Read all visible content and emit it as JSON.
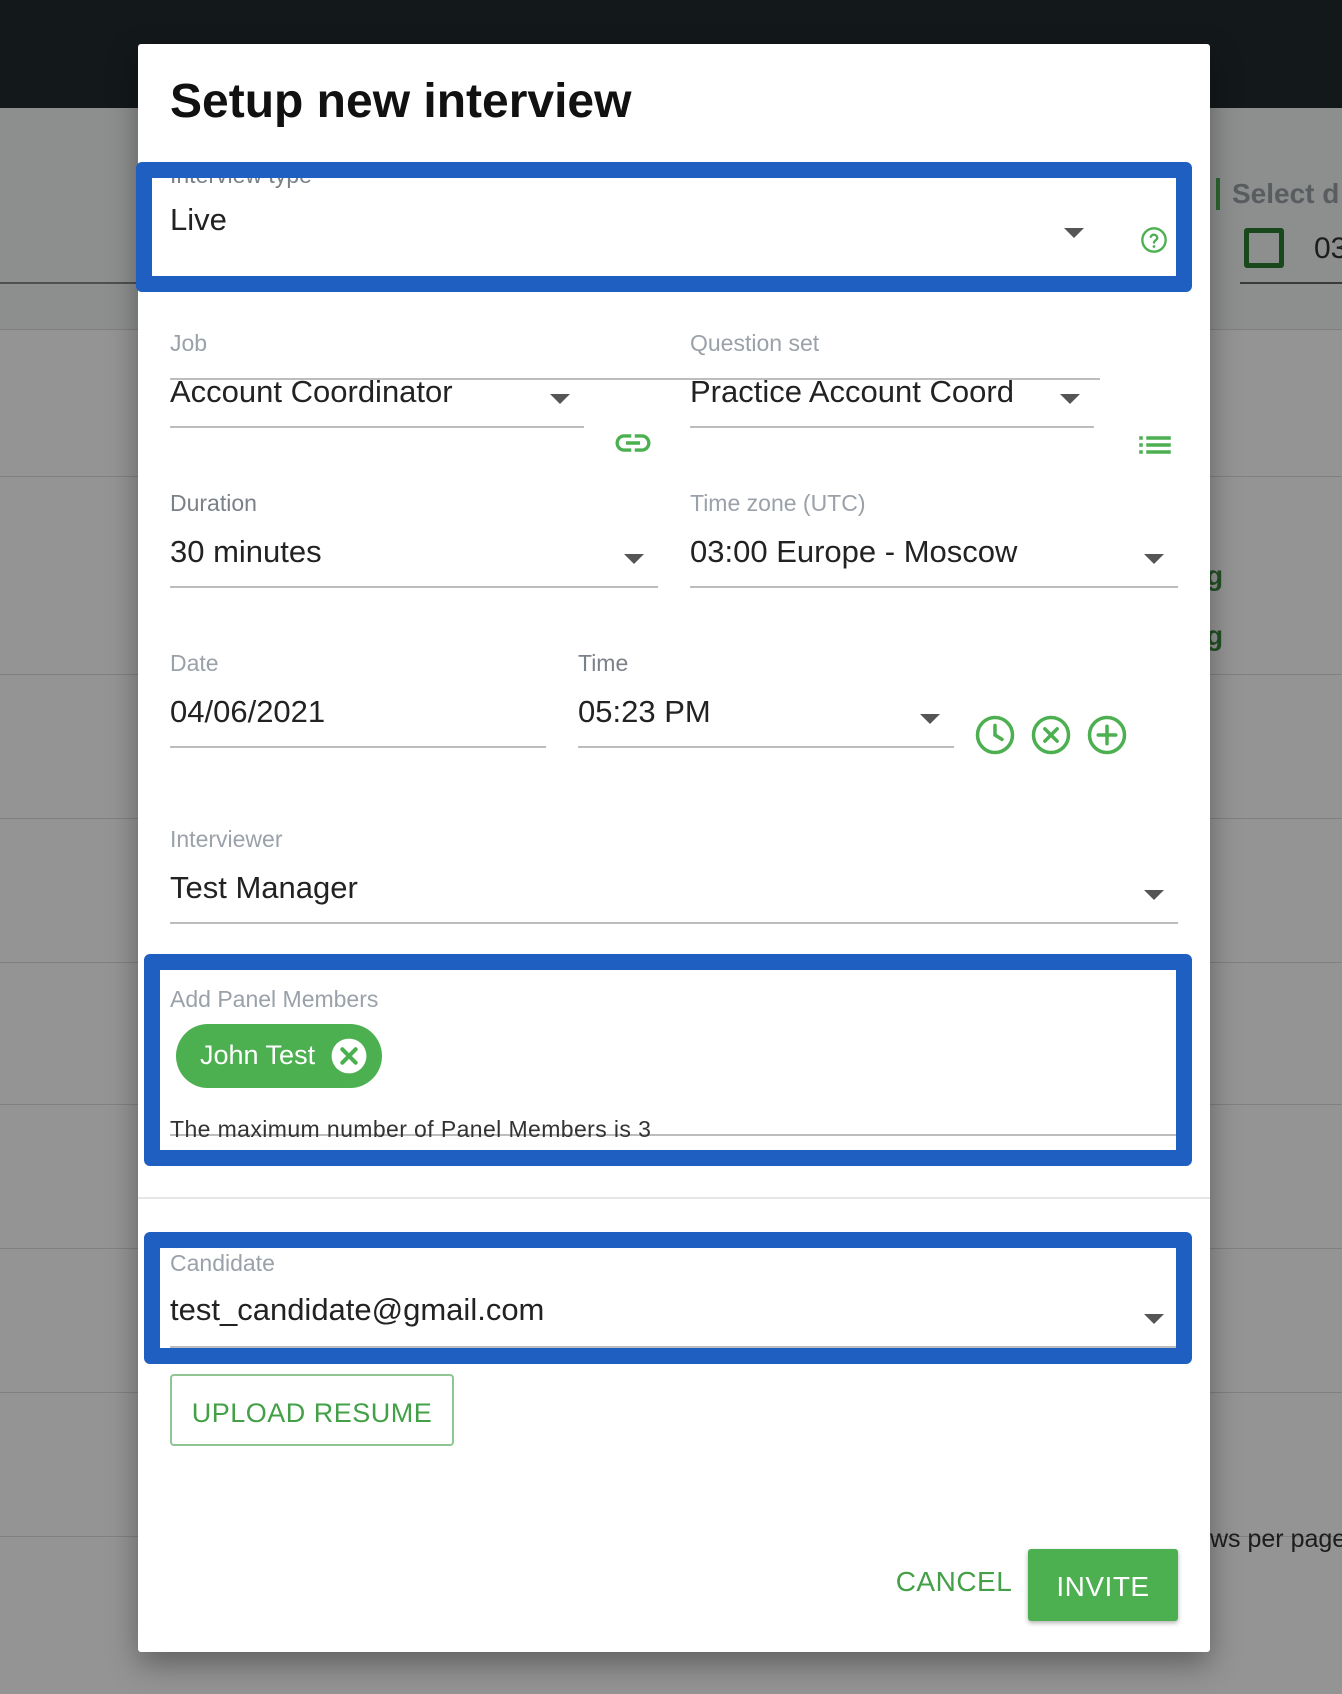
{
  "background": {
    "filter_label": "Select d",
    "date_partial": "03",
    "status_partial": "g",
    "rows_per_page_partial": "ws per page"
  },
  "dialog": {
    "title": "Setup new interview",
    "interview_type": {
      "label": "Interview type",
      "value": "Live",
      "help_icon": "help-circle-icon"
    },
    "job": {
      "label": "Job",
      "value": "Account Coordinator",
      "icon": "link-icon"
    },
    "question_set": {
      "label": "Question set",
      "value": "Practice Account Coord",
      "icon": "list-icon"
    },
    "duration": {
      "label": "Duration",
      "value": "30 minutes"
    },
    "time_zone": {
      "label": "Time zone (UTC)",
      "value": "03:00 Europe - Moscow"
    },
    "date": {
      "label": "Date",
      "value": "04/06/2021"
    },
    "time": {
      "label": "Time",
      "value": "05:23 PM",
      "icons": [
        "clock-icon",
        "clear-circle-icon",
        "add-circle-icon"
      ]
    },
    "interviewer": {
      "label": "Interviewer",
      "value": "Test Manager"
    },
    "panel_members": {
      "label": "Add Panel Members",
      "chips": [
        {
          "label": "John Test"
        }
      ],
      "helper_text": "The maximum number of Panel Members is 3"
    },
    "candidate": {
      "label": "Candidate",
      "value": "test_candidate@gmail.com"
    },
    "upload_resume_label": "UPLOAD RESUME",
    "cancel_label": "CANCEL",
    "invite_label": "INVITE"
  },
  "colors": {
    "accent": "#4caf50",
    "highlight_border": "#1f5fc2",
    "topbar": "#222a30"
  }
}
